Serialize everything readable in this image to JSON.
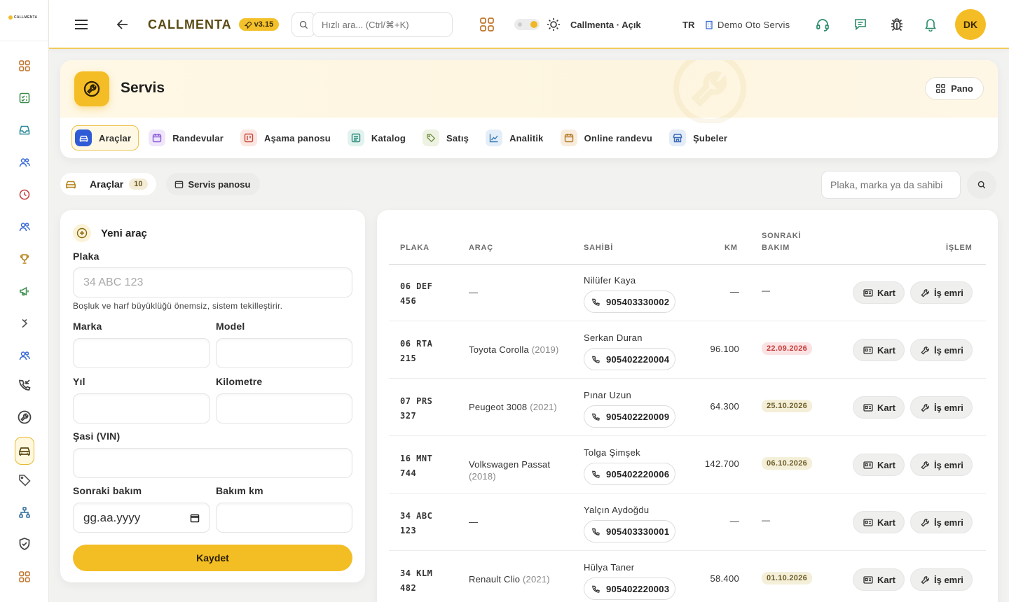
{
  "brand": {
    "rail_logo": "CALLMENTA",
    "name": "CALLMENTA",
    "version": "v3.15"
  },
  "topbar": {
    "quick_search_placeholder": "Hızlı ara... (Ctrl/⌘+K)",
    "status_label": "Callmenta · Açık",
    "language": "TR",
    "company": "Demo Oto Servis",
    "avatar_initials": "DK"
  },
  "module": {
    "title": "Servis",
    "pano_label": "Pano",
    "tabs": [
      {
        "label": "Araçlar",
        "icon": "car-icon",
        "color": "#2f5bd6",
        "bg": "#2f5bd6",
        "active": true
      },
      {
        "label": "Randevular",
        "icon": "calendar-icon",
        "color": "#8a5ad6",
        "bg": "#efe6fb",
        "active": false
      },
      {
        "label": "Aşama panosu",
        "icon": "kanban-icon",
        "color": "#c74a3a",
        "bg": "#fbe6e2",
        "active": false
      },
      {
        "label": "Katalog",
        "icon": "catalog-icon",
        "color": "#2a8a7a",
        "bg": "#e2f2ee",
        "active": false
      },
      {
        "label": "Satış",
        "icon": "tag-icon",
        "color": "#6a8a3a",
        "bg": "#eef2e2",
        "active": false
      },
      {
        "label": "Analitik",
        "icon": "chart-icon",
        "color": "#3a7ab6",
        "bg": "#e4eef8",
        "active": false
      },
      {
        "label": "Online randevu",
        "icon": "calendar-icon",
        "color": "#b57a2a",
        "bg": "#f8ecdc",
        "active": false
      },
      {
        "label": "Şubeler",
        "icon": "store-icon",
        "color": "#3a6ab6",
        "bg": "#e4ecf8",
        "active": false
      }
    ]
  },
  "subbar": {
    "vehicles_label": "Araçlar",
    "vehicles_count": "10",
    "service_board_label": "Servis panosu",
    "filter_placeholder": "Plaka, marka ya da sahibi"
  },
  "form": {
    "title": "Yeni araç",
    "plate_label": "Plaka",
    "plate_placeholder": "34 ABC 123",
    "plate_hint": "Boşluk ve harf büyüklüğü önemsiz, sistem tekilleştirir.",
    "brand_label": "Marka",
    "model_label": "Model",
    "year_label": "Yıl",
    "km_label": "Kilometre",
    "vin_label": "Şasi (VIN)",
    "next_service_label": "Sonraki bakım",
    "next_service_placeholder": "gg.aa.yyyy",
    "service_km_label": "Bakım km",
    "save_label": "Kaydet"
  },
  "table": {
    "headers": {
      "plate": "PLAKA",
      "vehicle": "ARAÇ",
      "owner": "SAHİBİ",
      "km": "KM",
      "next_service_1": "SONRAKİ",
      "next_service_2": "BAKIM",
      "action": "İŞLEM"
    },
    "card_label": "Kart",
    "work_order_label": "İş emri",
    "rows": [
      {
        "plate_1": "06 DEF",
        "plate_2": "456",
        "vehicle": "—",
        "year": "",
        "owner": "Nilüfer Kaya",
        "phone": "905403330002",
        "km": "—",
        "next": "—",
        "next_style": "none"
      },
      {
        "plate_1": "06 RTA",
        "plate_2": "215",
        "vehicle": "Toyota Corolla",
        "year": "(2019)",
        "owner": "Serkan Duran",
        "phone": "905402220004",
        "km": "96.100",
        "next": "22.09.2026",
        "next_style": "red"
      },
      {
        "plate_1": "07 PRS",
        "plate_2": "327",
        "vehicle": "Peugeot 3008",
        "year": "(2021)",
        "owner": "Pınar Uzun",
        "phone": "905402220009",
        "km": "64.300",
        "next": "25.10.2026",
        "next_style": "tan"
      },
      {
        "plate_1": "16 MNT",
        "plate_2": "744",
        "vehicle": "Volkswagen Passat",
        "year": "(2018)",
        "owner": "Tolga Şimşek",
        "phone": "905402220006",
        "km": "142.700",
        "next": "06.10.2026",
        "next_style": "tan"
      },
      {
        "plate_1": "34 ABC",
        "plate_2": "123",
        "vehicle": "—",
        "year": "",
        "owner": "Yalçın Aydoğdu",
        "phone": "905403330001",
        "km": "—",
        "next": "—",
        "next_style": "none"
      },
      {
        "plate_1": "34 KLM",
        "plate_2": "482",
        "vehicle": "Renault Clio",
        "year": "(2021)",
        "owner": "Hülya Taner",
        "phone": "905402220003",
        "km": "58.400",
        "next": "01.10.2026",
        "next_style": "tan"
      }
    ]
  },
  "rail_items": [
    {
      "icon": "dashboard-icon",
      "color": "#c0732a"
    },
    {
      "icon": "checklist-icon",
      "color": "#3a8a4a"
    },
    {
      "icon": "inbox-icon",
      "color": "#2a8a9a"
    },
    {
      "icon": "users-icon",
      "color": "#3a6ad6"
    },
    {
      "icon": "clock-icon",
      "color": "#c73a3a"
    },
    {
      "icon": "team-icon",
      "color": "#3a6ad6"
    },
    {
      "icon": "trophy-icon",
      "color": "#b5831a"
    },
    {
      "icon": "megaphone-icon",
      "color": "#3a8a4a"
    },
    {
      "icon": "integration-icon",
      "color": "#555555"
    },
    {
      "icon": "contacts-icon",
      "color": "#3a6ad6"
    },
    {
      "icon": "call-incoming-icon",
      "color": "#444444"
    },
    {
      "icon": "wrench-icon",
      "color": "#444444"
    },
    {
      "icon": "car-icon",
      "color": "#555555"
    },
    {
      "icon": "tag-icon",
      "color": "#555555"
    },
    {
      "icon": "hierarchy-icon",
      "color": "#2a6a9a"
    },
    {
      "icon": "shield-icon",
      "color": "#444444"
    },
    {
      "icon": "grid-icon",
      "color": "#c0732a"
    }
  ]
}
